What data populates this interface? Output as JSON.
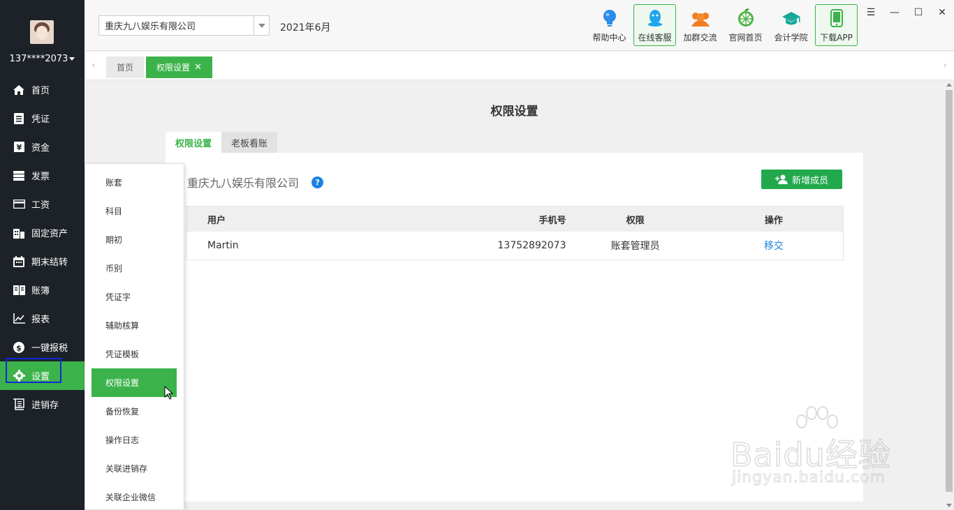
{
  "user": {
    "phone": "137****2073"
  },
  "nav": [
    {
      "label": "首页",
      "icon": "home-icon"
    },
    {
      "label": "凭证",
      "icon": "voucher-icon"
    },
    {
      "label": "资金",
      "icon": "yen-icon"
    },
    {
      "label": "发票",
      "icon": "invoice-icon"
    },
    {
      "label": "工资",
      "icon": "card-icon"
    },
    {
      "label": "固定资产",
      "icon": "building-icon"
    },
    {
      "label": "期末结转",
      "icon": "calendar-icon"
    },
    {
      "label": "账簿",
      "icon": "book-icon"
    },
    {
      "label": "报表",
      "icon": "chart-icon"
    },
    {
      "label": "一键报税",
      "icon": "dollar-icon"
    },
    {
      "label": "设置",
      "icon": "gear-icon"
    },
    {
      "label": "进销存",
      "icon": "cart-icon"
    }
  ],
  "header": {
    "company": "重庆九八娱乐有限公司",
    "period": "2021年6月",
    "tools": [
      {
        "label": "帮助中心",
        "icon": "bulb-icon"
      },
      {
        "label": "在线客服",
        "icon": "qq-icon"
      },
      {
        "label": "加群交流",
        "icon": "group-icon"
      },
      {
        "label": "官网首页",
        "icon": "orange-icon"
      },
      {
        "label": "会计学院",
        "icon": "graduation-icon"
      },
      {
        "label": "下载APP",
        "icon": "phone-icon"
      }
    ]
  },
  "tabs": {
    "home": "首页",
    "current": "权限设置"
  },
  "page": {
    "title": "权限设置",
    "inner_tabs": [
      "权限设置",
      "老板看账"
    ],
    "company": "重庆九八娱乐有限公司",
    "help": "?",
    "add_button": "新增成员",
    "table": {
      "headers": [
        "用户",
        "手机号",
        "权限",
        "操作"
      ],
      "rows": [
        {
          "user": "Martin",
          "phone": "13752892073",
          "permission": "账套管理员",
          "action": "移交"
        }
      ]
    }
  },
  "submenu": [
    "账套",
    "科目",
    "期初",
    "币别",
    "凭证字",
    "辅助核算",
    "凭证模板",
    "权限设置",
    "备份恢复",
    "操作日志",
    "关联进销存",
    "关联企业微信"
  ],
  "watermark": {
    "text": "Baidu经验",
    "sub": "jingyan.baidu.com"
  },
  "colors": {
    "sidebar": "#1c2227",
    "accent": "#3bb34a",
    "link": "#1a82e2"
  }
}
